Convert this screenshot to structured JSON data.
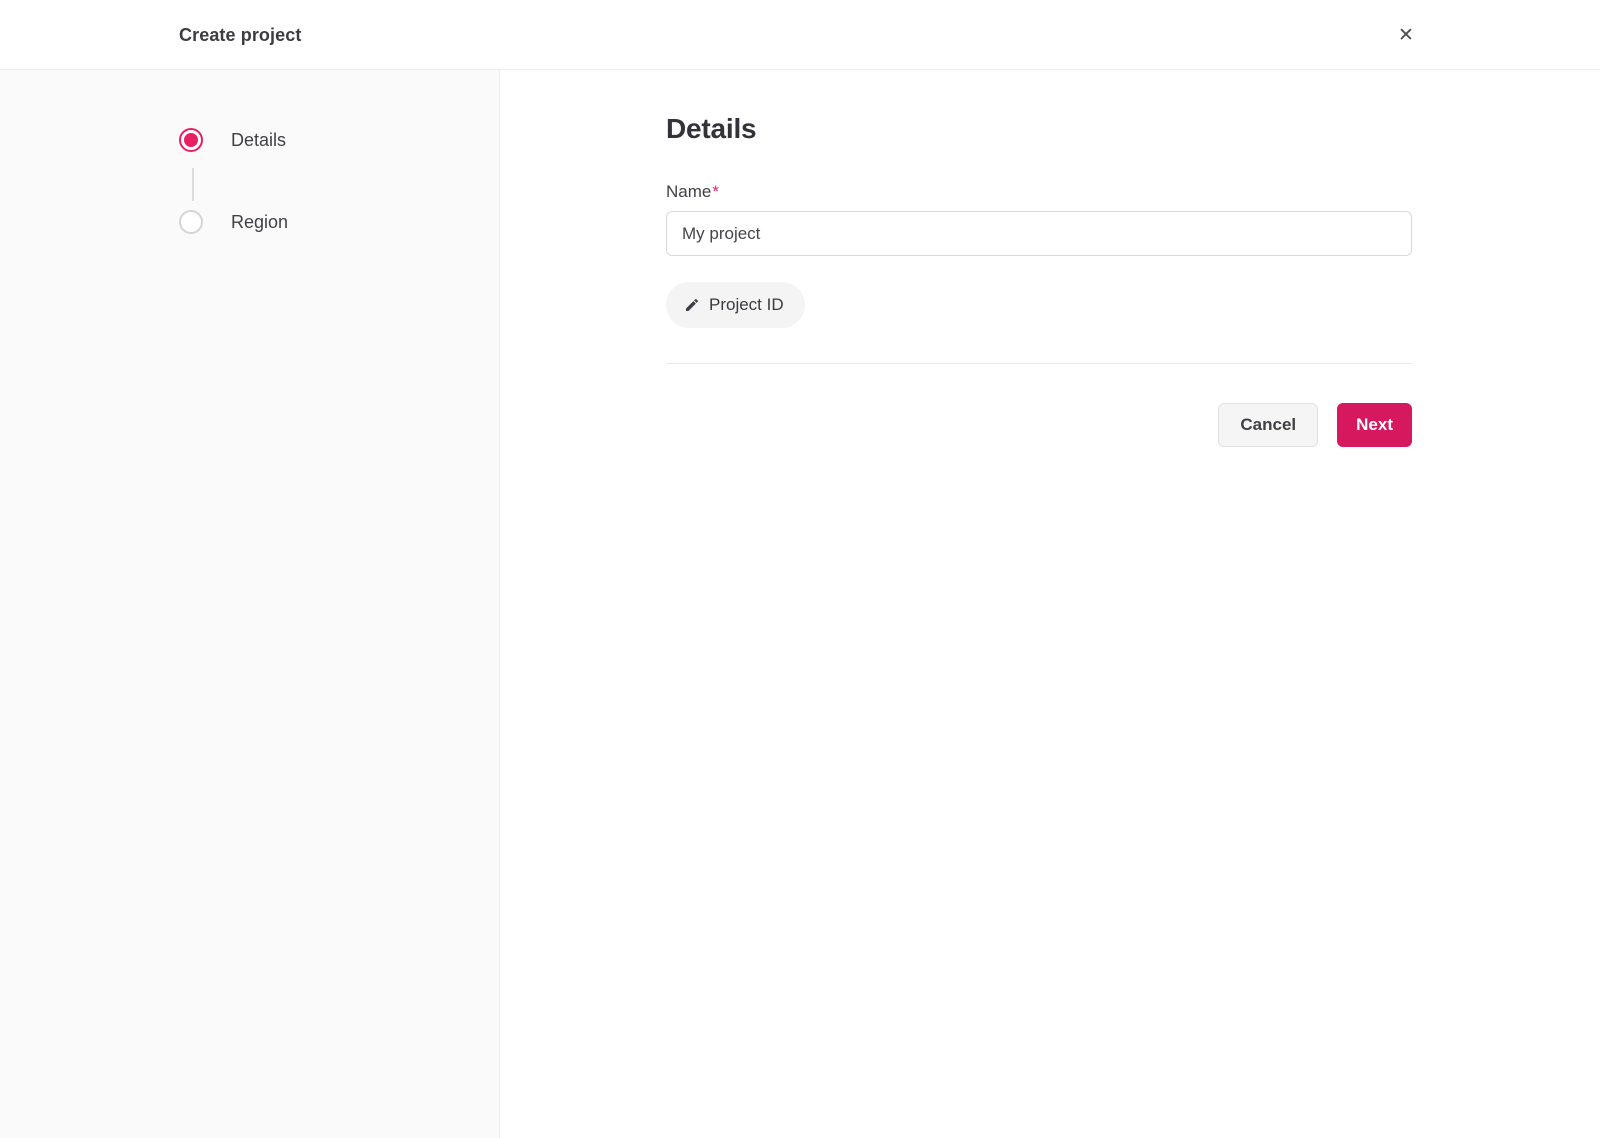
{
  "header": {
    "title": "Create project",
    "close_glyph": "✕"
  },
  "stepper": {
    "steps": [
      {
        "label": "Details",
        "state": "active"
      },
      {
        "label": "Region",
        "state": "inactive"
      }
    ]
  },
  "main": {
    "heading": "Details",
    "form": {
      "name_label": "Name",
      "required_marker": "*",
      "name_value": "My project",
      "project_id_label": "Project ID"
    },
    "actions": {
      "cancel_label": "Cancel",
      "next_label": "Next"
    }
  },
  "icons": {
    "close-icon": "✕",
    "pencil-icon": "pencil"
  },
  "colors": {
    "accent_button": "#d6185e",
    "accent_step": "#e91f63",
    "sidebar_bg": "#fafafa",
    "divider": "#e9e9ee",
    "text_primary": "#3f3f46"
  }
}
